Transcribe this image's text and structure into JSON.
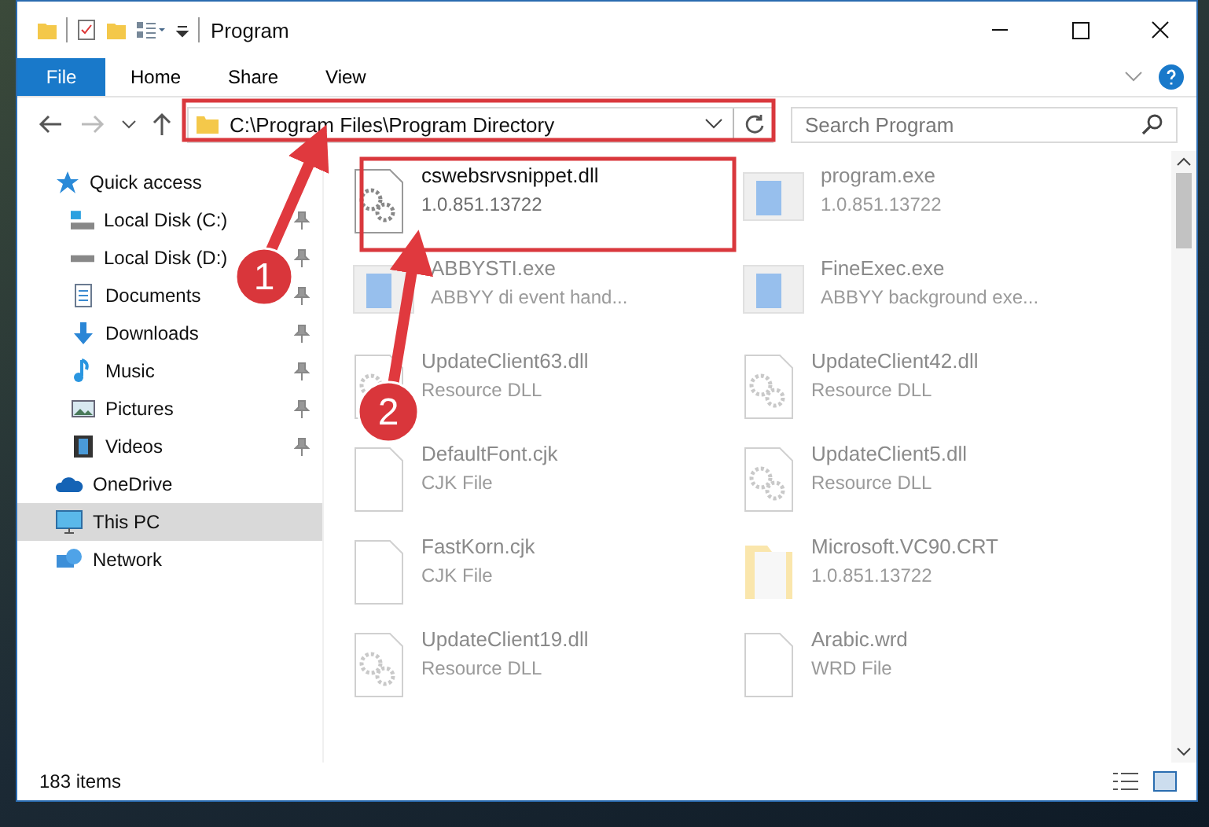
{
  "window": {
    "title": "Program"
  },
  "ribbon": {
    "file_menu": "File",
    "tabs": [
      "Home",
      "Share",
      "View"
    ]
  },
  "address_bar": {
    "path": "C:\\Program Files\\Program Directory"
  },
  "search": {
    "placeholder": "Search Program"
  },
  "sidebar": {
    "items": [
      {
        "label": "Quick access",
        "selected": false,
        "children": [
          {
            "label": "Local Disk (C:)",
            "selected": false
          },
          {
            "label": "Local Disk (D:)",
            "selected": false
          },
          {
            "label": "Documents",
            "selected": false
          },
          {
            "label": "Downloads",
            "selected": false
          },
          {
            "label": "Music",
            "selected": false
          },
          {
            "label": "Pictures",
            "selected": false
          },
          {
            "label": "Videos",
            "selected": false
          }
        ]
      },
      {
        "label": "OneDrive",
        "selected": false
      },
      {
        "label": "This PC",
        "selected": true
      },
      {
        "label": "Network",
        "selected": false
      }
    ]
  },
  "files": [
    {
      "name": "cswebsrvsnippet.dll",
      "detail": "1.0.851.13722",
      "dimmed": false
    },
    {
      "name": "program.exe",
      "detail": "1.0.851.13722",
      "dimmed": true
    },
    {
      "name": "ABBYSTI.exe",
      "detail": "ABBYY di event hand...",
      "dimmed": true
    },
    {
      "name": "FineExec.exe",
      "detail": "ABBYY background exe...",
      "dimmed": true
    },
    {
      "name": "UpdateClient63.dll",
      "detail": "Resource DLL",
      "dimmed": true
    },
    {
      "name": "UpdateClient42.dll",
      "detail": "Resource DLL",
      "dimmed": true
    },
    {
      "name": "DefaultFont.cjk",
      "detail": "CJK File",
      "dimmed": true
    },
    {
      "name": "UpdateClient5.dll",
      "detail": "Resource DLL",
      "dimmed": true
    },
    {
      "name": "FastKorn.cjk",
      "detail": "CJK File",
      "dimmed": true
    },
    {
      "name": "Microsoft.VC90.CRT",
      "detail": "1.0.851.13722",
      "dimmed": true
    },
    {
      "name": "UpdateClient19.dll",
      "detail": "Resource DLL",
      "dimmed": true
    },
    {
      "name": "Arabic.wrd",
      "detail": "WRD File",
      "dimmed": true
    }
  ],
  "status_bar": {
    "item_count": "183 items"
  },
  "annotations": [
    {
      "number": "1"
    },
    {
      "number": "2"
    }
  ]
}
